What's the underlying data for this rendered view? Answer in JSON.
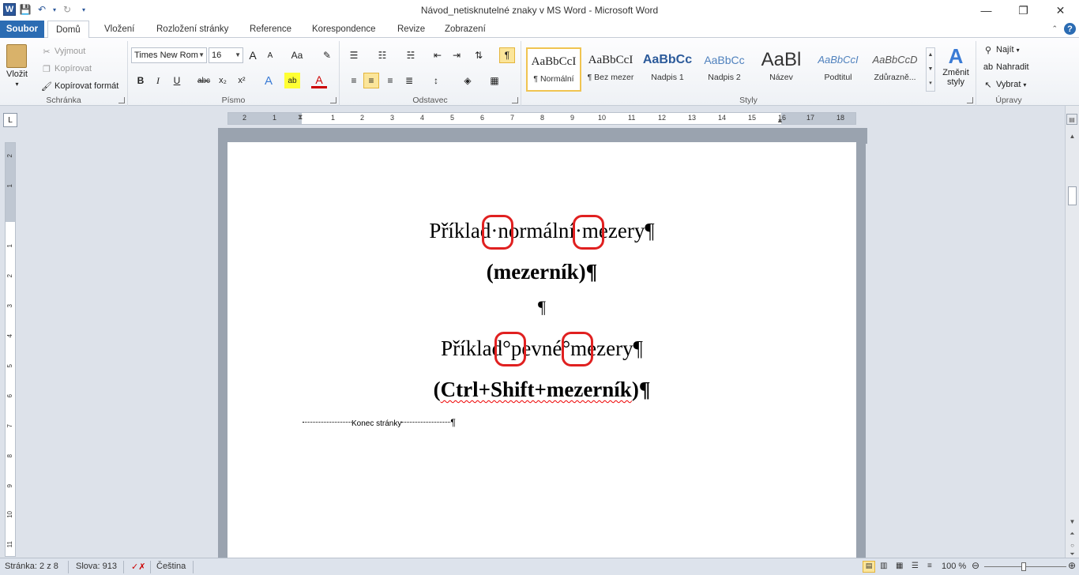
{
  "window": {
    "title": "Návod_netisknutelné znaky v MS Word  -  Microsoft Word",
    "minimize": "—",
    "maximize": "❐",
    "close": "✕"
  },
  "qat": {
    "logo": "W",
    "save": "💾",
    "undo": "↶",
    "redo": "↻",
    "dropdown": "▾"
  },
  "tabs": [
    "Soubor",
    "Domů",
    "Vložení",
    "Rozložení stránky",
    "Reference",
    "Korespondence",
    "Revize",
    "Zobrazení"
  ],
  "ribbon": {
    "clipboard": {
      "label": "Schránka",
      "paste": "Vložit",
      "cut": "Vyjmout",
      "copy": "Kopírovat",
      "format_painter": "Kopírovat formát"
    },
    "font": {
      "label": "Písmo",
      "font_name": "Times New Rom",
      "font_size": "16",
      "grow": "A",
      "shrink": "A",
      "case": "Aa",
      "clear": "✎",
      "bold": "B",
      "italic": "I",
      "underline": "U",
      "strike": "abc",
      "sub": "x₂",
      "sup": "x²",
      "effects": "A",
      "highlight": "ab",
      "color": "A"
    },
    "paragraph": {
      "label": "Odstavec",
      "pilcrow": "¶"
    },
    "styles": {
      "label": "Styly",
      "items": [
        {
          "preview": "AaBbCcI",
          "name": "¶ Normální"
        },
        {
          "preview": "AaBbCcI",
          "name": "¶ Bez mezer"
        },
        {
          "preview": "AaBbCc",
          "name": "Nadpis 1"
        },
        {
          "preview": "AaBbCc",
          "name": "Nadpis 2"
        },
        {
          "preview": "AaBl",
          "name": "Název"
        },
        {
          "preview": "AaBbCcI",
          "name": "Podtitul"
        },
        {
          "preview": "AaBbCcD",
          "name": "Zdůrazně..."
        }
      ],
      "change": "Změnit styly"
    },
    "editing": {
      "label": "Úpravy",
      "find": "Najít",
      "replace": "Nahradit",
      "select": "Vybrat"
    }
  },
  "ruler": {
    "h_numbers": [
      "2",
      "1",
      "1",
      "2",
      "3",
      "4",
      "5",
      "6",
      "7",
      "8",
      "9",
      "10",
      "11",
      "12",
      "13",
      "14",
      "15",
      "16",
      "17",
      "18"
    ],
    "v_numbers": [
      "2",
      "1",
      "1",
      "2",
      "3",
      "4",
      "5",
      "6",
      "7",
      "8",
      "9",
      "10",
      "11"
    ],
    "tab_selector": "L"
  },
  "document": {
    "p1": "Příklad·normální·mezery¶",
    "p2_open": "(mezerník)¶",
    "p3": "¶",
    "p4": "Příklad°pevné°mezery¶",
    "p5_pre": "(",
    "p5_squiggle": "Ctrl+Shift+mezerník",
    "p5_post": ")¶",
    "page_break": "Konec stránky",
    "page_break_pilcrow": "¶"
  },
  "statusbar": {
    "page": "Stránka: 2 z 8",
    "words": "Slova: 913",
    "language": "Čeština",
    "zoom": "100 %",
    "zoom_level_percent": 100
  },
  "colors": {
    "accent": "#2b579a",
    "file_tab": "#2b6cb3",
    "highlight": "#e02020"
  }
}
